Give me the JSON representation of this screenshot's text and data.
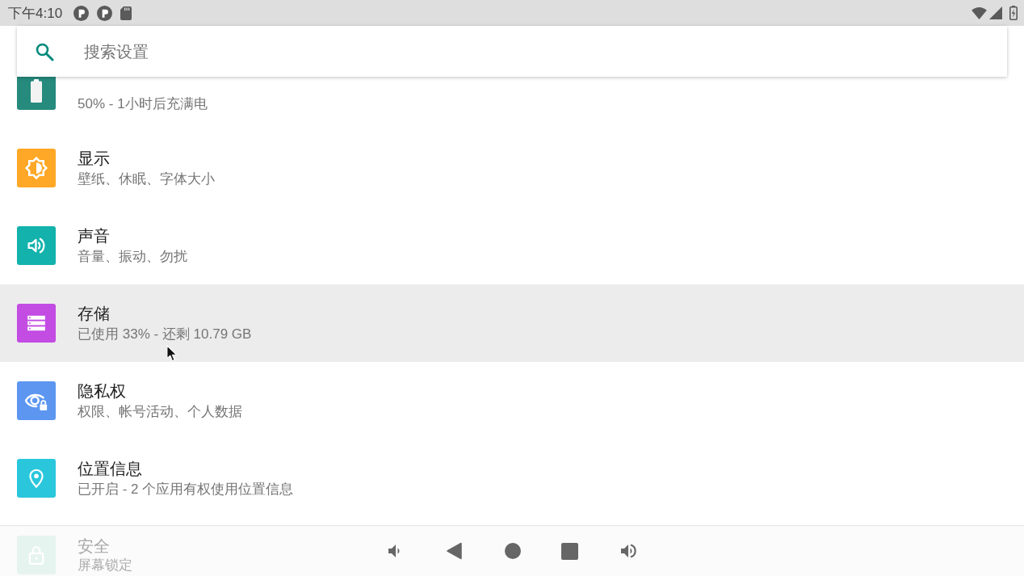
{
  "status_bar": {
    "time": "下午4:10"
  },
  "search": {
    "placeholder": "搜索设置"
  },
  "settings": [
    {
      "summary": "50% - 1小时后充满电",
      "color": "#268a7d",
      "selected": false
    },
    {
      "title": "显示",
      "summary": "壁纸、休眠、字体大小",
      "color": "#ffa726",
      "selected": false
    },
    {
      "title": "声音",
      "summary": "音量、振动、勿扰",
      "color": "#13b2ac",
      "selected": false
    },
    {
      "title": "存储",
      "summary": "已使用 33% - 还剩 10.79 GB",
      "color": "#c34ce3",
      "selected": true
    },
    {
      "title": "隐私权",
      "summary": "权限、帐号活动、个人数据",
      "color": "#5c96f0",
      "selected": false
    },
    {
      "title": "位置信息",
      "summary": "已开启 - 2 个应用有权使用位置信息",
      "color": "#2ac7dc",
      "selected": false
    },
    {
      "title": "安全",
      "summary": "屏幕锁定",
      "color": "#e6f4ef",
      "selected": false
    }
  ]
}
